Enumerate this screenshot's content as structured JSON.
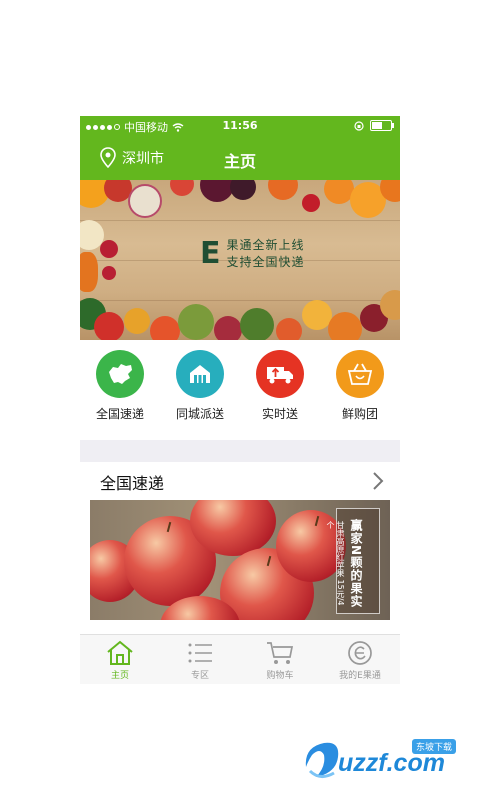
{
  "status_bar": {
    "carrier": "中国移动",
    "time": "11:56"
  },
  "nav": {
    "city": "深圳市",
    "title": "主页"
  },
  "banner": {
    "big_letter": "E",
    "line1": "果通全新上线",
    "line2": "支持全国快递"
  },
  "quick_actions": [
    {
      "label": "全国速递",
      "icon": "china-map-icon",
      "color": "#3bb54a"
    },
    {
      "label": "同城派送",
      "icon": "house-icon",
      "color": "#27aebd"
    },
    {
      "label": "实时送",
      "icon": "delivery-truck-icon",
      "color": "#e53323"
    },
    {
      "label": "鲜购团",
      "icon": "shopping-basket-icon",
      "color": "#f29a1a"
    }
  ],
  "section": {
    "title": "全国速递"
  },
  "promo": {
    "title": "赢家N颗的果实",
    "sub1": "甘肃高原红苹果",
    "sub2": "15元/4个"
  },
  "tabs": [
    {
      "label": "主页",
      "icon": "home-icon",
      "active": true
    },
    {
      "label": "专区",
      "icon": "list-icon",
      "active": false
    },
    {
      "label": "购物车",
      "icon": "cart-icon",
      "active": false
    },
    {
      "label": "我的E果通",
      "icon": "profile-e-icon",
      "active": false
    }
  ],
  "watermark": {
    "text": "uzzf.com",
    "badge": "东坡下载"
  },
  "colors": {
    "brand_green": "#63b71e",
    "inactive_gray": "#999999"
  }
}
